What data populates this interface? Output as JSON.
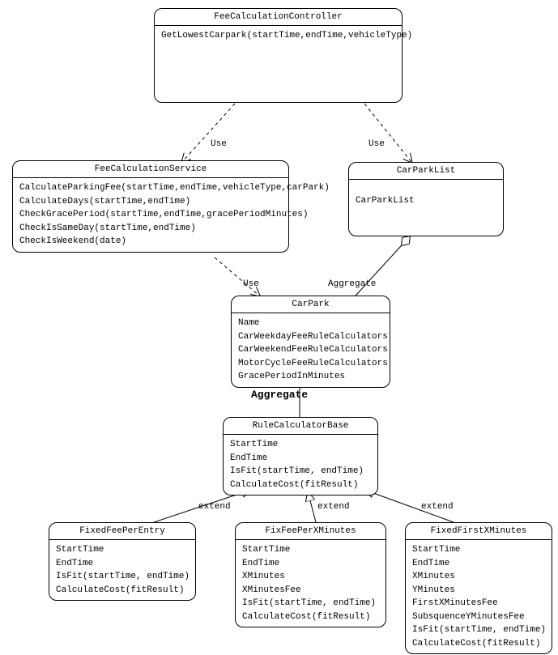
{
  "relations": {
    "use": "Use",
    "aggregate": "Aggregate",
    "extend": "extend"
  },
  "classes": {
    "controller": {
      "name": "FeeCalculationController",
      "members": [
        "GetLowestCarpark(startTime,endTime,vehicleType)"
      ]
    },
    "service": {
      "name": "FeeCalculationService",
      "members": [
        "CalculateParkingFee(startTime,endTime,vehicleType,carPark)",
        "CalculateDays(startTime,endTime)",
        "CheckGracePeriod(startTime,endTime,gracePeriodMinutes)",
        "CheckIsSameDay(startTime,endTime)",
        "CheckIsWeekend(date)"
      ]
    },
    "carparkList": {
      "name": "CarParkList",
      "members": [
        "CarParkList"
      ]
    },
    "carpark": {
      "name": "CarPark",
      "members": [
        "Name",
        "CarWeekdayFeeRuleCalculators",
        "CarWeekendFeeRuleCalculators",
        "MotorCycleFeeRuleCalculators",
        "GracePeriodInMinutes"
      ]
    },
    "ruleBase": {
      "name": "RuleCalculatorBase",
      "members": [
        "StartTime",
        "EndTime",
        "IsFit(startTime, endTime)",
        "CalculateCost(fitResult)"
      ]
    },
    "fixedEntry": {
      "name": "FixedFeePerEntry",
      "members": [
        "StartTime",
        "EndTime",
        "IsFit(startTime, endTime)",
        "CalculateCost(fitResult)"
      ]
    },
    "fixPerX": {
      "name": "FixFeePerXMinutes",
      "members": [
        "StartTime",
        "EndTime",
        "XMinutes",
        "XMinutesFee",
        "IsFit(startTime, endTime)",
        "CalculateCost(fitResult)"
      ]
    },
    "fixedFirstX": {
      "name": "FixedFirstXMinutes",
      "members": [
        "StartTime",
        "EndTime",
        "XMinutes",
        "YMinutes",
        "FirstXMinutesFee",
        "SubsquenceYMinutesFee",
        "IsFit(startTime, endTime)",
        "CalculateCost(fitResult)"
      ]
    }
  }
}
